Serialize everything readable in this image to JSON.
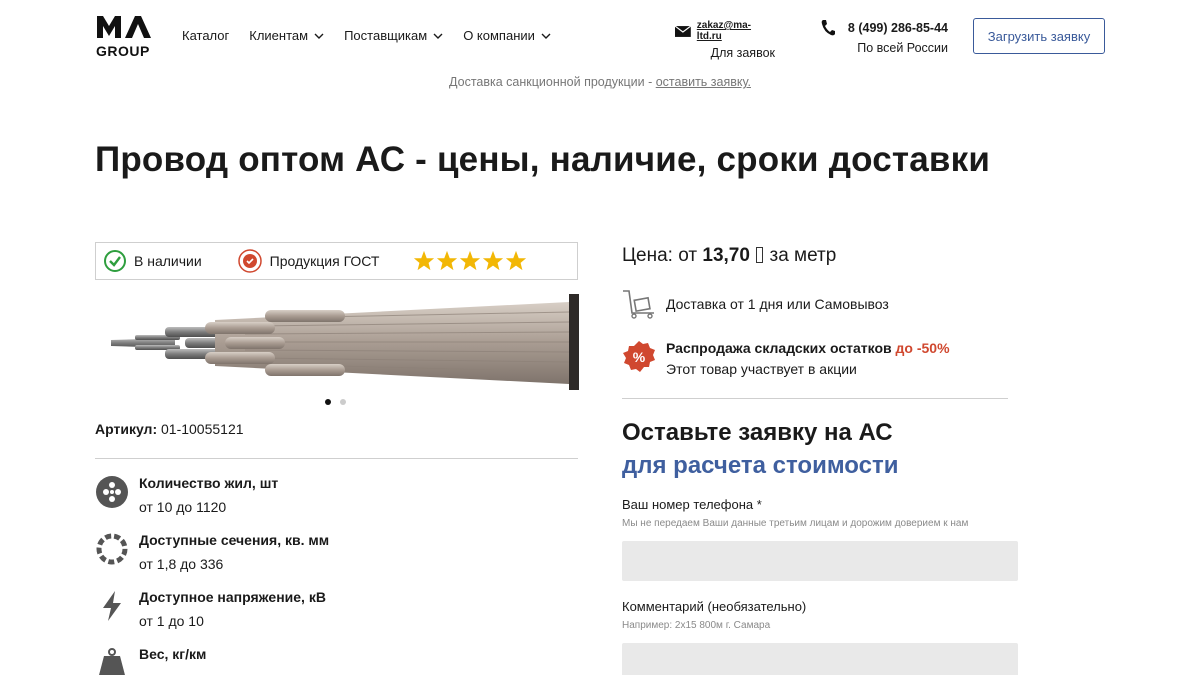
{
  "header": {
    "logo_text": "MA GROUP",
    "nav": [
      {
        "label": "Каталог",
        "has_dropdown": false
      },
      {
        "label": "Клиентам",
        "has_dropdown": true
      },
      {
        "label": "Поставщикам",
        "has_dropdown": true
      },
      {
        "label": "О компании",
        "has_dropdown": true
      }
    ],
    "email": "zakaz@ma-ltd.ru",
    "email_sub": "Для заявок",
    "phone": "8 (499) 286-85-44",
    "phone_sub": "По всей России",
    "cta_label": "Загрузить заявку"
  },
  "banner": {
    "text": "Доставка санкционной продукции - ",
    "link": "оставить заявку."
  },
  "page_title": "Провод оптом АС - цены, наличие, сроки доставки",
  "badges": {
    "in_stock": "В наличии",
    "gost": "Продукция ГОСТ",
    "stars": 5
  },
  "article": {
    "label": "Артикул:",
    "value": "01-10055121"
  },
  "specs": [
    {
      "name": "Количество жил, шт",
      "value": "от 10 до 1120",
      "icon": "cores-icon"
    },
    {
      "name": "Доступные сечения, кв. мм",
      "value": "от 1,8 до 336",
      "icon": "section-icon"
    },
    {
      "name": "Доступное напряжение, кВ",
      "value": "от 1 до 10",
      "icon": "voltage-icon"
    },
    {
      "name": "Вес, кг/км",
      "value": "",
      "icon": "weight-icon"
    }
  ],
  "price": {
    "prefix": "Цена: от ",
    "value": "13,70",
    "currency_symbol": "",
    "suffix": " за метр"
  },
  "delivery": "Доставка от 1 дня или Самовывоз",
  "sale": {
    "title": "Распродажа складских остатков",
    "discount": "до -50%",
    "subtitle": "Этот товар участвует в акции"
  },
  "form": {
    "title": "Оставьте заявку на АС",
    "subtitle": "для расчета стоимости",
    "phone_label": "Ваш номер телефона *",
    "phone_hint": "Мы не передаем Ваши данные третьим лицам и дорожим доверием к нам",
    "phone_value": "",
    "comment_label": "Комментарий (необязательно)",
    "comment_hint": "Например: 2x15 800м г. Самара",
    "comment_value": ""
  },
  "colors": {
    "accent": "#3f5f9f",
    "sale": "#d0482f",
    "check": "#2e9e3e",
    "star": "#f2b705"
  },
  "carousel": {
    "count": 2,
    "active": 1
  }
}
